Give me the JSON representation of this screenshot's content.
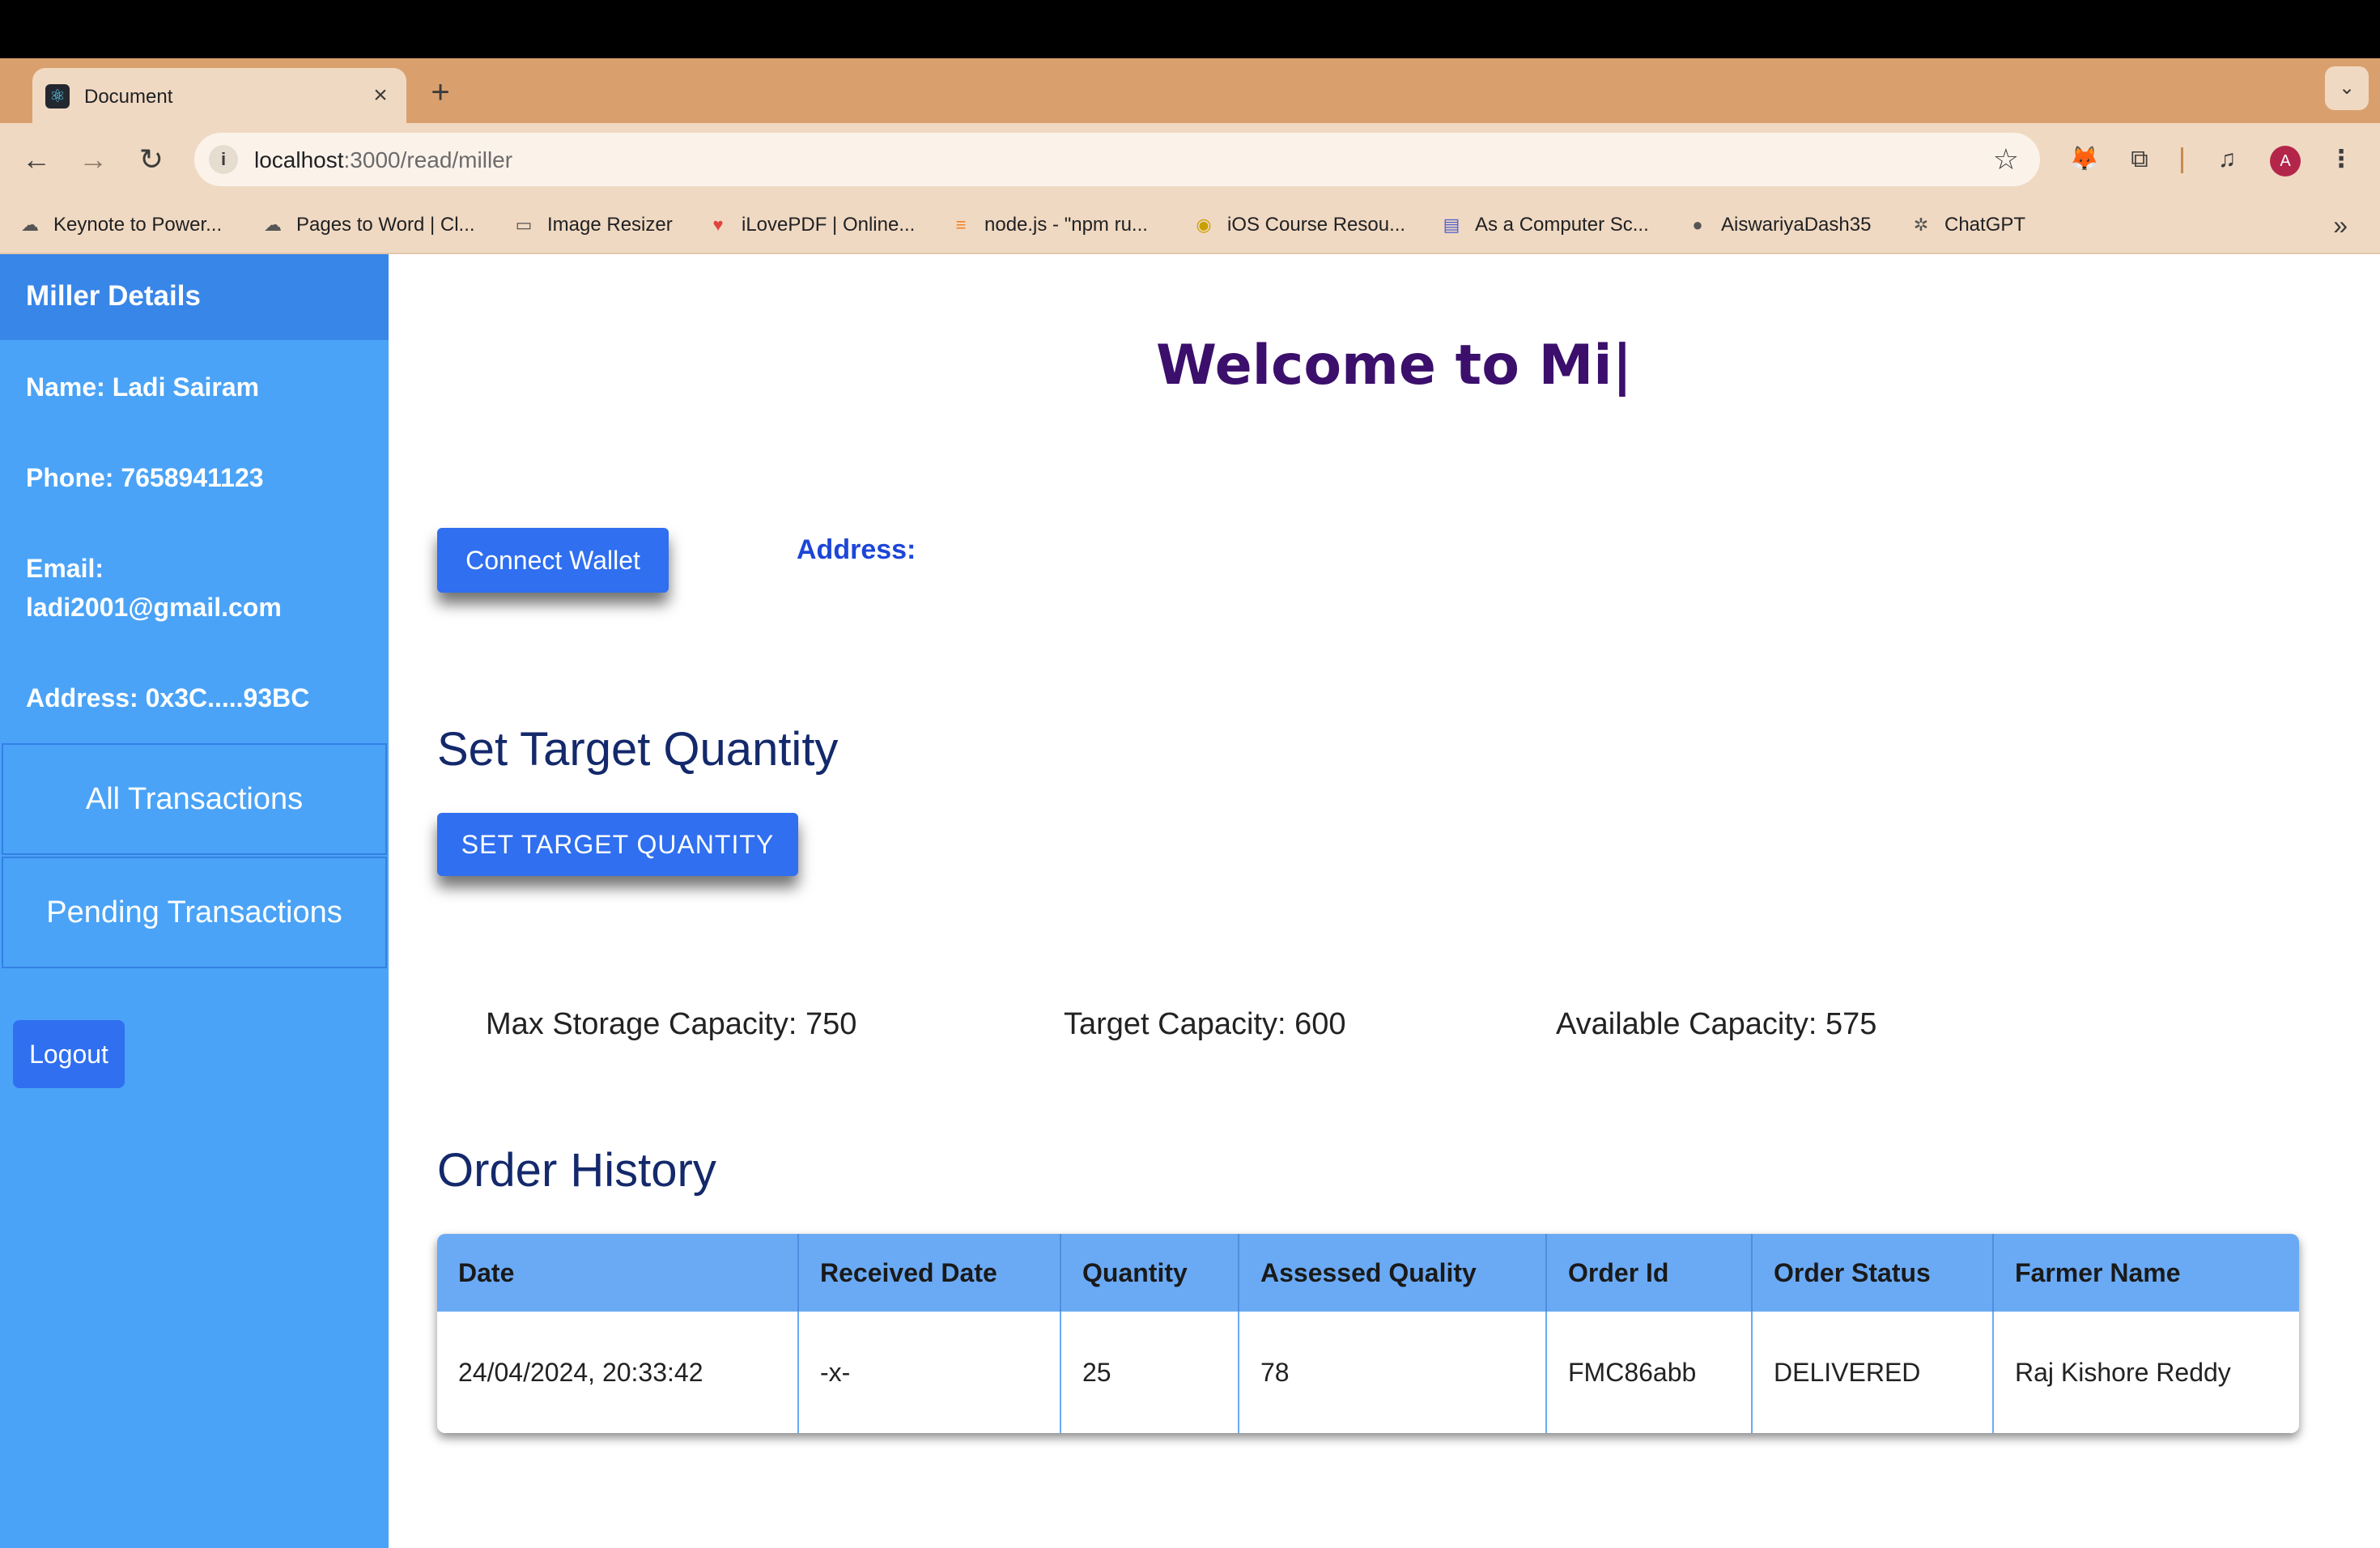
{
  "browser": {
    "tab_title": "Document",
    "url_host": "localhost",
    "url_path": ":3000/read/miller",
    "bookmarks": [
      {
        "label": "Keynote to Power...",
        "icon": "cloud-icon"
      },
      {
        "label": "Pages to Word | Cl...",
        "icon": "cloud-icon"
      },
      {
        "label": "Image Resizer",
        "icon": "image-icon"
      },
      {
        "label": "iLovePDF | Online...",
        "icon": "heart-icon"
      },
      {
        "label": "node.js - \"npm ru...",
        "icon": "stackoverflow-icon"
      },
      {
        "label": "iOS Course Resou...",
        "icon": "course-icon"
      },
      {
        "label": "As a Computer Sc...",
        "icon": "printer-icon"
      },
      {
        "label": "AiswariyaDash35",
        "icon": "github-icon"
      },
      {
        "label": "ChatGPT",
        "icon": "chatgpt-icon"
      }
    ],
    "avatar_letter": "A"
  },
  "sidebar": {
    "title": "Miller Details",
    "name": "Name: Ladi Sairam",
    "phone": "Phone: 7658941123",
    "email_label": "Email:",
    "email": "ladi2001@gmail.com",
    "address": "Address: 0x3C.....93BC",
    "nav": [
      "All Transactions",
      "Pending Transactions"
    ],
    "logout": "Logout"
  },
  "main": {
    "welcome": "Welcome to Mi|",
    "connect_wallet": "Connect Wallet",
    "address_label": "Address:",
    "set_target_title": "Set Target Quantity",
    "set_target_button": "SET TARGET QUANTITY",
    "max_capacity": "Max Storage Capacity: 750",
    "target_capacity": "Target Capacity: 600",
    "available_capacity": "Available Capacity: 575",
    "order_history_title": "Order History",
    "table": {
      "columns": [
        "Date",
        "Received Date",
        "Quantity",
        "Assessed Quality",
        "Order Id",
        "Order Status",
        "Farmer Name"
      ],
      "rows": [
        [
          "24/04/2024, 20:33:42",
          "-x-",
          "25",
          "78",
          "FMC86abb",
          "DELIVERED",
          "Raj Kishore Reddy"
        ]
      ]
    }
  },
  "colors": {
    "sidebar": "#4aa3f7",
    "sidebar_header": "#3886e8",
    "button": "#2f6ff0",
    "heading": "#14296b",
    "welcome": "#3b0f6b",
    "table_header": "#6aaaf5"
  }
}
